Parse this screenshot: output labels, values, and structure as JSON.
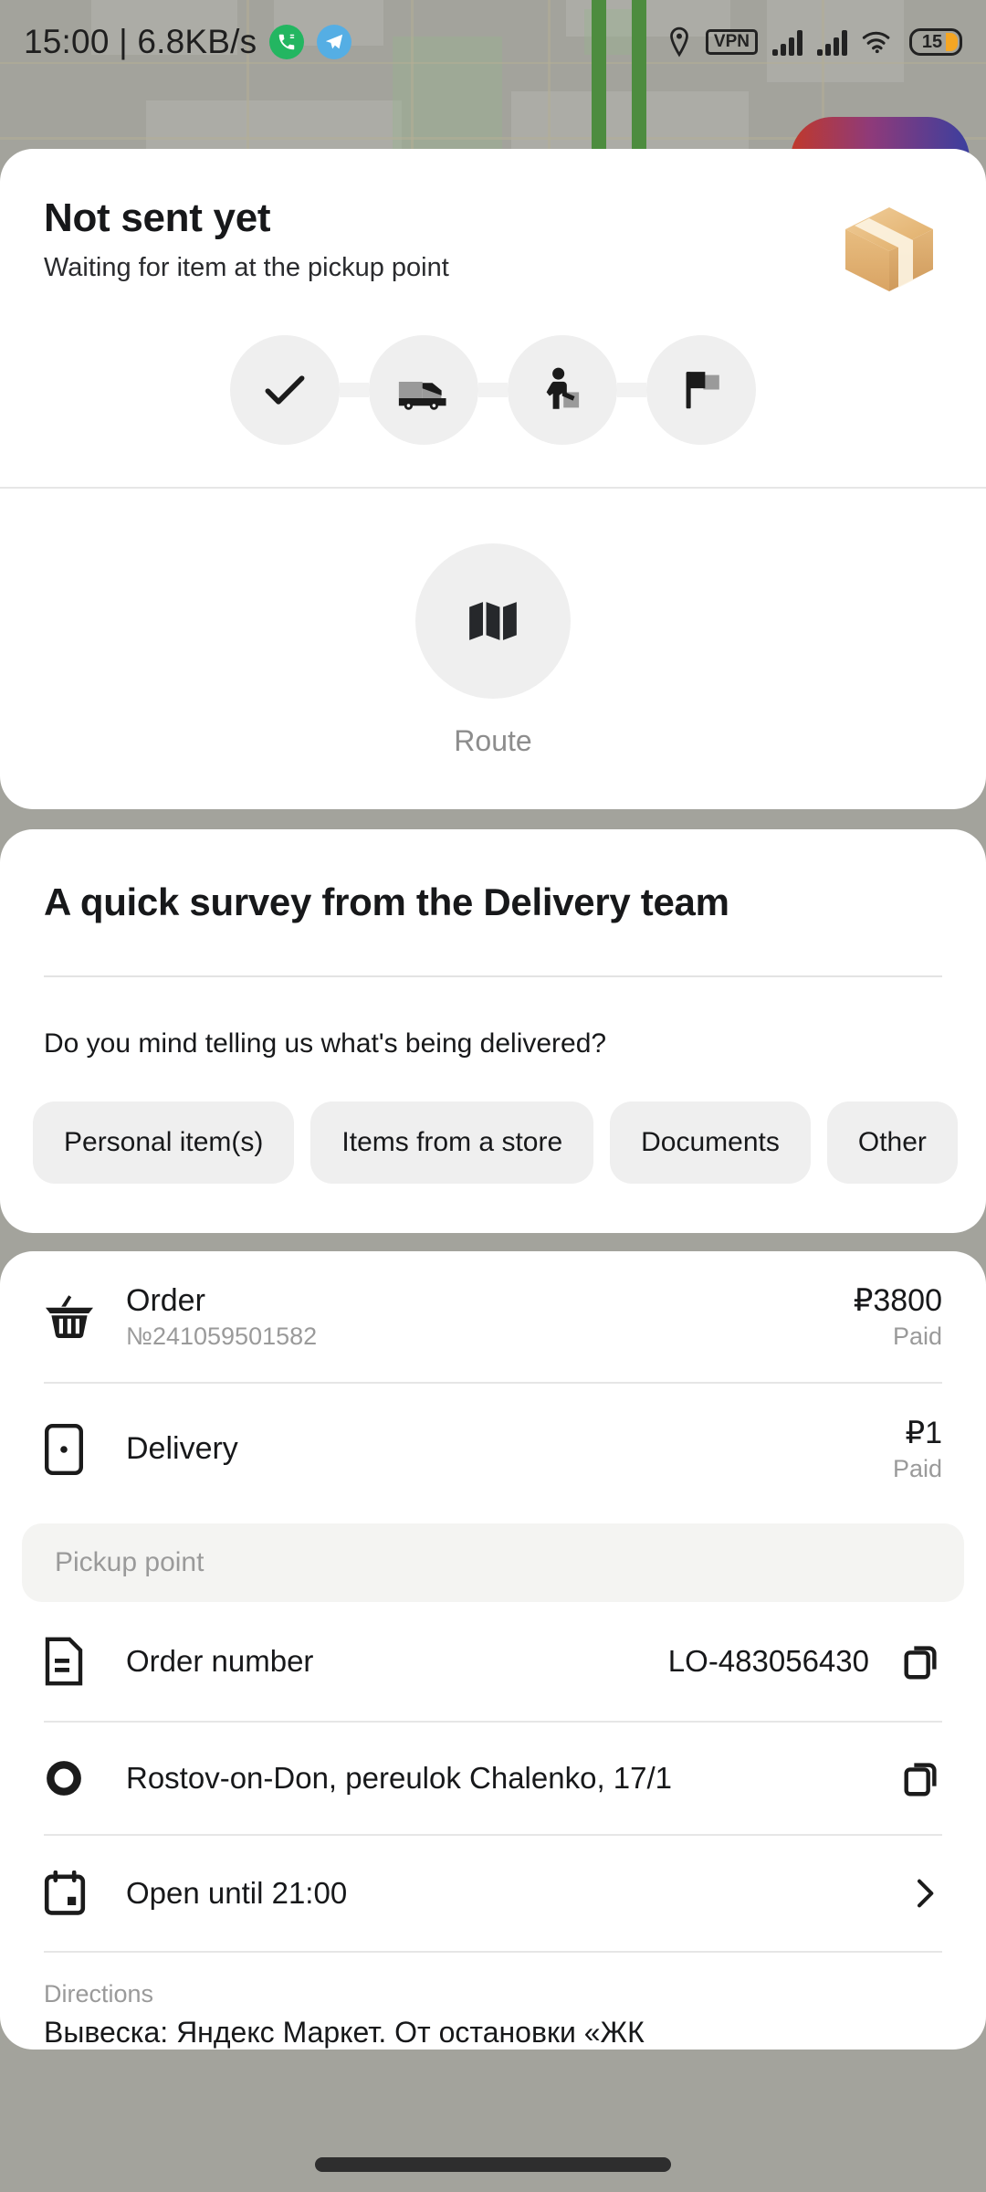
{
  "status_bar": {
    "clock": "15:00 | 6.8KB/s",
    "vpn_label": "VPN",
    "battery_level": "15",
    "icons": [
      "phone-app-icon",
      "telegram-app-icon",
      "location-pin-icon",
      "vpn-icon",
      "signal-bars-icon",
      "signal-bars-icon",
      "wifi-icon",
      "battery-icon"
    ]
  },
  "header": {
    "title": "Not sent yet",
    "subtitle": "Waiting for item at the pickup point",
    "package_icon": "package-box-icon"
  },
  "progress": {
    "steps": [
      {
        "name": "step-confirmed",
        "icon": "check-icon",
        "state": "done"
      },
      {
        "name": "step-pickup",
        "icon": "truck-icon",
        "state": "pending"
      },
      {
        "name": "step-courier",
        "icon": "courier-icon",
        "state": "pending"
      },
      {
        "name": "step-delivered",
        "icon": "flag-icon",
        "state": "pending"
      }
    ]
  },
  "route": {
    "label": "Route",
    "icon": "map-icon"
  },
  "survey": {
    "title": "A quick survey from the Delivery team",
    "question": "Do you mind telling us what's being delivered?",
    "options": [
      "Personal item(s)",
      "Items from a store",
      "Documents",
      "Other"
    ]
  },
  "payment": {
    "order": {
      "icon": "basket-icon",
      "title": "Order",
      "number": "№241059501582",
      "amount": "₽3800",
      "status": "Paid"
    },
    "delivery": {
      "icon": "parcel-icon",
      "title": "Delivery",
      "amount": "₽1",
      "status": "Paid"
    }
  },
  "pickup_point": {
    "section_label": "Pickup point",
    "order_number": {
      "icon": "document-icon",
      "label": "Order number",
      "value": "LO-483056430",
      "action_icon": "copy-icon"
    },
    "address": {
      "icon": "circle-marker-icon",
      "value": "Rostov-on-Don, pereulok Chalenko, 17/1",
      "action_icon": "copy-icon"
    },
    "hours": {
      "icon": "calendar-icon",
      "value": "Open until 21:00",
      "action_icon": "chevron-right-icon"
    },
    "directions": {
      "label": "Directions",
      "text": "Вывеска: Яндекс Маркет. От остановки «ЖК"
    }
  },
  "colors": {
    "accent_green": "#23b661",
    "accent_blue": "#55aee4",
    "battery_orange": "#f5a623",
    "chip_bg": "#efefef",
    "package_tan": "#e7b873"
  }
}
